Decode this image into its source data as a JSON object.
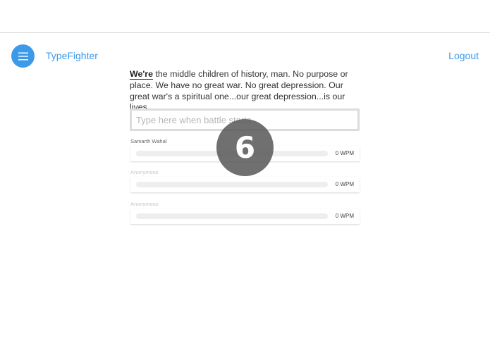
{
  "header": {
    "brand": "TypeFighter",
    "logout_label": "Logout",
    "accent_color": "#3d9ae8"
  },
  "menu": {
    "icon": "hamburger-icon"
  },
  "passage": {
    "current_word": "We're",
    "rest": " the middle children of history, man. No purpose or place. We have no great war. No great depression. Our great war's a spiritual one...our great depression...is our lives."
  },
  "input": {
    "placeholder": "Type here when battle starts...",
    "value": ""
  },
  "players": [
    {
      "name": "Samarth Wahal",
      "wpm": "0 WPM",
      "progress": 0
    },
    {
      "name": "Anonymous",
      "wpm": "0 WPM",
      "progress": 0
    },
    {
      "name": "Anonymous",
      "wpm": "0 WPM",
      "progress": 0
    }
  ],
  "countdown": {
    "value": "6"
  }
}
